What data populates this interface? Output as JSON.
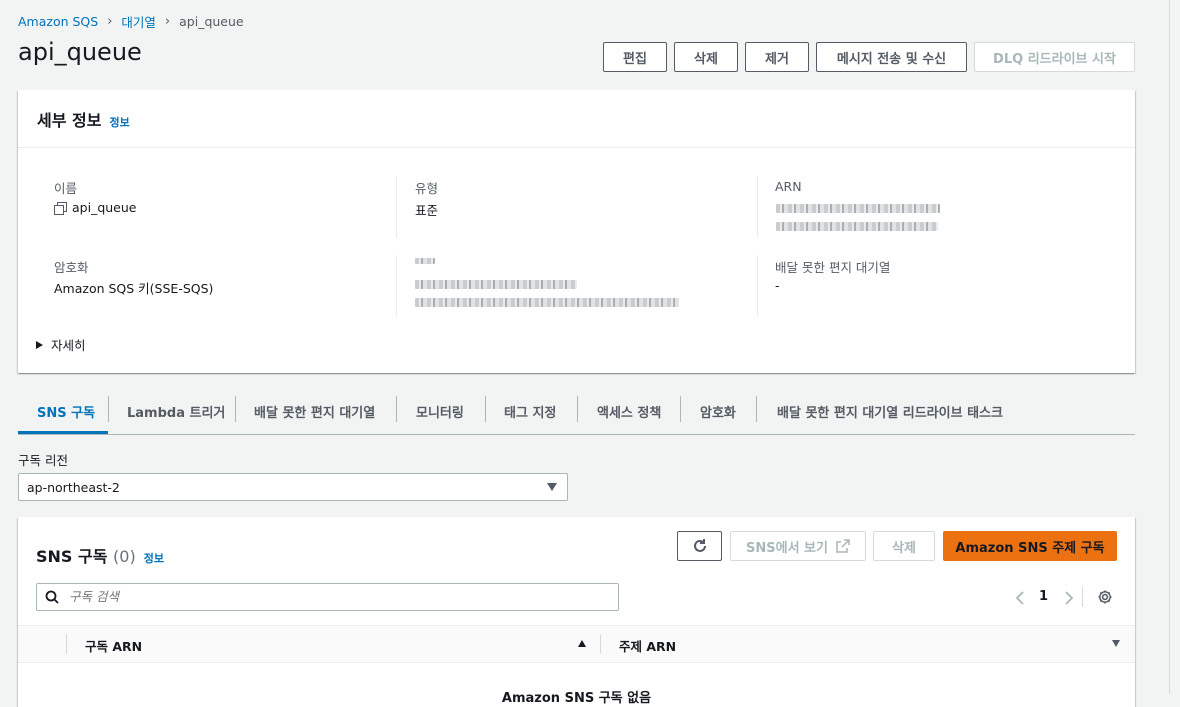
{
  "breadcrumb": {
    "root": "Amazon SQS",
    "queues": "대기열",
    "current": "api_queue"
  },
  "title": "api_queue",
  "header_buttons": {
    "edit": "편집",
    "delete": "삭제",
    "purge": "제거",
    "send_receive": "메시지 전송 및 수신",
    "dlq_redrive": "DLQ 리드라이브 시작"
  },
  "details": {
    "heading": "세부 정보",
    "info": "정보",
    "name_label": "이름",
    "name_value": "api_queue",
    "type_label": "유형",
    "type_value": "표준",
    "arn_label": "ARN",
    "encryption_label": "암호화",
    "encryption_value": "Amazon SQS 키(SSE-SQS)",
    "dlq_label": "배달 못한 편지 대기열",
    "dlq_value": "-",
    "more": "자세히"
  },
  "tabs": [
    {
      "label": "SNS 구독"
    },
    {
      "label": "Lambda 트리거"
    },
    {
      "label": "배달 못한 편지 대기열"
    },
    {
      "label": "모니터링"
    },
    {
      "label": "태그 지정"
    },
    {
      "label": "액세스 정책"
    },
    {
      "label": "암호화"
    },
    {
      "label": "배달 못한 편지 대기열 리드라이브 태스크"
    }
  ],
  "region": {
    "label": "구독 리전",
    "value": "ap-northeast-2"
  },
  "sns": {
    "heading": "SNS 구독",
    "count": "(0)",
    "info": "정보",
    "refresh_icon": "refresh-icon",
    "view_in_sns": "SNS에서 보기",
    "delete": "삭제",
    "subscribe": "Amazon SNS 주제 구독",
    "search_placeholder": "구독 검색",
    "page": "1",
    "col_subscription_arn": "구독 ARN",
    "col_topic_arn": "주제 ARN",
    "empty": "Amazon SNS 구독 없음"
  },
  "colors": {
    "link": "#0073bb",
    "primary": "#ec7211",
    "text": "#16191f"
  }
}
